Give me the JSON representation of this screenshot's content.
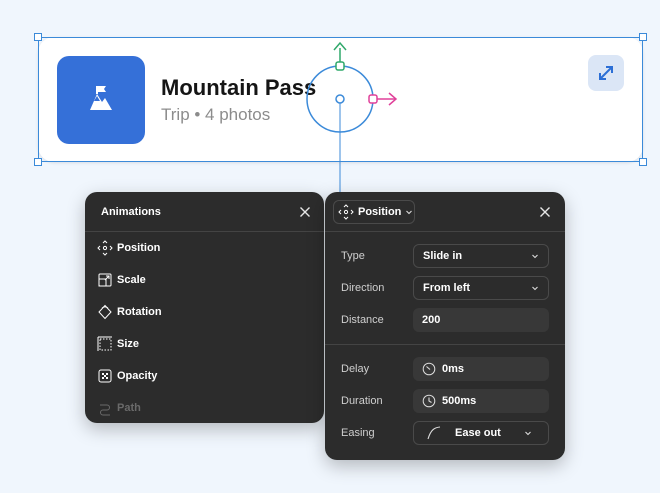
{
  "card": {
    "title": "Mountain Pass",
    "subtitle": "Trip • 4 photos",
    "thumb_icon": "mountain-flag-icon",
    "expand_icon": "expand-arrows-icon"
  },
  "colors": {
    "thumb": "#3570d8",
    "selection": "#3b8ad9",
    "gizmo_y": "#2fa86a",
    "gizmo_x": "#e0409a",
    "panel_bg": "#2c2c2c"
  },
  "animations_panel": {
    "title": "Animations",
    "items": [
      {
        "label": "Position",
        "icon": "position-icon"
      },
      {
        "label": "Scale",
        "icon": "scale-icon"
      },
      {
        "label": "Rotation",
        "icon": "rotation-icon"
      },
      {
        "label": "Size",
        "icon": "size-icon"
      },
      {
        "label": "Opacity",
        "icon": "opacity-icon"
      },
      {
        "label": "Path",
        "icon": "path-icon",
        "disabled": true
      }
    ]
  },
  "position_panel": {
    "dropdown_label": "Position",
    "type": {
      "label": "Type",
      "value": "Slide in"
    },
    "direction": {
      "label": "Direction",
      "value": "From left"
    },
    "distance": {
      "label": "Distance",
      "value": "200"
    },
    "delay": {
      "label": "Delay",
      "value": "0ms"
    },
    "duration": {
      "label": "Duration",
      "value": "500ms"
    },
    "easing": {
      "label": "Easing",
      "value": "Ease out"
    }
  }
}
